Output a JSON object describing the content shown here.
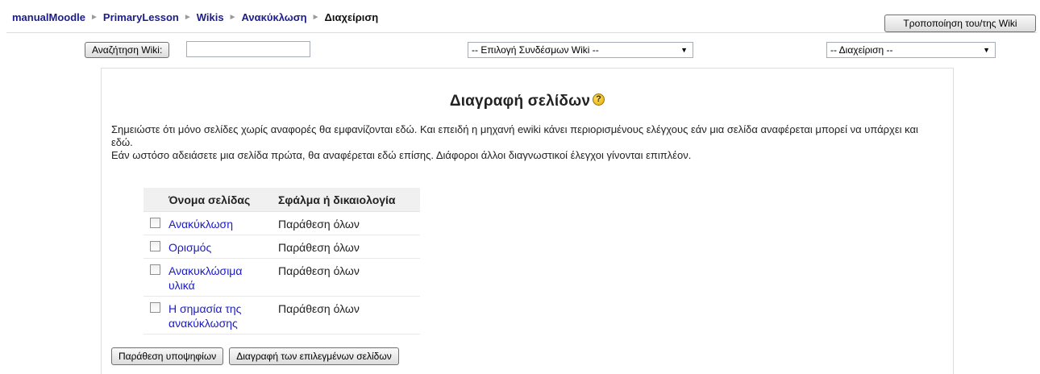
{
  "breadcrumb": {
    "items": [
      "manualMoodle",
      "PrimaryLesson",
      "Wikis",
      "Ανακύκλωση"
    ],
    "current": "Διαχείριση"
  },
  "header": {
    "edit_wiki_label": "Τροποποίηση του/της Wiki"
  },
  "toolbar": {
    "search_label": "Αναζήτηση Wiki:",
    "search_value": "",
    "links_select": "-- Επιλογή Συνδέσμων Wiki --",
    "admin_select": "-- Διαχείριση --"
  },
  "main": {
    "title": "Διαγραφή σελίδων",
    "help_icon": "help-question-icon",
    "description_line1": "Σημειώστε ότι μόνο σελίδες χωρίς αναφορές θα εμφανίζονται εδώ. Και επειδή η μηχανή ewiki κάνει περιορισμένους ελέγχους εάν μια σελίδα αναφέρεται μπορεί να υπάρχει και εδώ.",
    "description_line2": "Εάν ωστόσο αδειάσετε μια σελίδα πρώτα, θα αναφέρεται εδώ επίσης. Διάφοροι άλλοι διαγνωστικοί έλεγχοι γίνονται επιπλέον."
  },
  "table": {
    "headers": [
      "",
      "Όνομα σελίδας",
      "Σφάλμα ή δικαιολογία"
    ],
    "rows": [
      {
        "name": "Ανακύκλωση",
        "reason": "Παράθεση όλων"
      },
      {
        "name": "Ορισμός",
        "reason": "Παράθεση όλων"
      },
      {
        "name": "Ανακυκλώσιμα υλικά",
        "reason": "Παράθεση όλων"
      },
      {
        "name": "Η σημασία της ανακύκλωσης",
        "reason": "Παράθεση όλων"
      }
    ]
  },
  "actions": {
    "list_candidates": "Παράθεση υποψηφίων",
    "delete_selected": "Διαγραφή των επιλεγμένων σελίδων"
  },
  "colors": {
    "link": "#1a1acc",
    "breadcrumb": "#1c1c8a",
    "header_bg": "#f0f0f0"
  }
}
